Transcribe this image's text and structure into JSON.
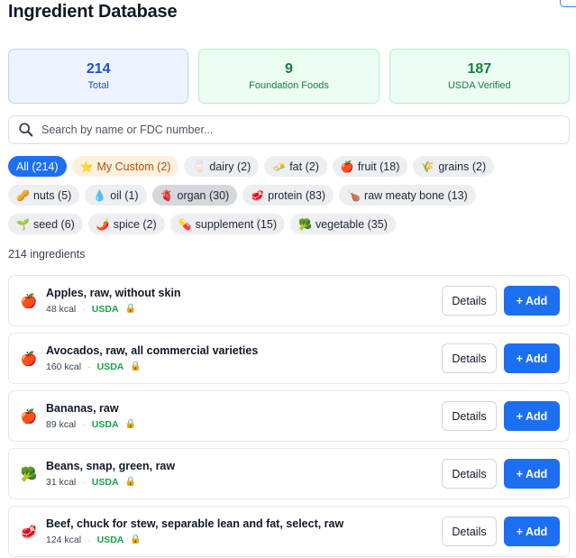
{
  "header": {
    "title": "Ingredient Database",
    "close_label": "✕"
  },
  "stats": [
    {
      "value": "214",
      "label": "Total"
    },
    {
      "value": "9",
      "label": "Foundation Foods"
    },
    {
      "value": "187",
      "label": "USDA Verified"
    }
  ],
  "search": {
    "placeholder": "Search by name or FDC number...",
    "value": ""
  },
  "filters": [
    {
      "label": "All (214)",
      "icon": "",
      "icon_name": ""
    },
    {
      "label": "My Custom (2)",
      "icon": "⭐",
      "icon_name": "star-icon"
    },
    {
      "label": "dairy (2)",
      "icon": "🥛",
      "icon_name": "milk-glass-icon"
    },
    {
      "label": "fat (2)",
      "icon": "🧈",
      "icon_name": "butter-icon"
    },
    {
      "label": "fruit (18)",
      "icon": "🍎",
      "icon_name": "apple-icon"
    },
    {
      "label": "grains (2)",
      "icon": "🌾",
      "icon_name": "wheat-icon"
    },
    {
      "label": "nuts (5)",
      "icon": "🥜",
      "icon_name": "peanut-icon"
    },
    {
      "label": "oil (1)",
      "icon": "💧",
      "icon_name": "droplet-icon"
    },
    {
      "label": "organ (30)",
      "icon": "🫀",
      "icon_name": "heart-organ-icon"
    },
    {
      "label": "protein (83)",
      "icon": "🥩",
      "icon_name": "meat-icon"
    },
    {
      "label": "raw meaty bone (13)",
      "icon": "🍗",
      "icon_name": "drumstick-icon"
    },
    {
      "label": "seed (6)",
      "icon": "🌱",
      "icon_name": "seedling-icon"
    },
    {
      "label": "spice (2)",
      "icon": "🌶️",
      "icon_name": "chili-pepper-icon"
    },
    {
      "label": "supplement (15)",
      "icon": "💊",
      "icon_name": "pill-icon"
    },
    {
      "label": "vegetable (35)",
      "icon": "🥦",
      "icon_name": "broccoli-icon"
    }
  ],
  "results_count": "214 ingredients",
  "ingredients": [
    {
      "icon": "🍎",
      "icon_name": "apple-icon",
      "name": "Apples, raw, without skin",
      "kcal": "48 kcal",
      "source": "USDA"
    },
    {
      "icon": "🍎",
      "icon_name": "apple-icon",
      "name": "Avocados, raw, all commercial varieties",
      "kcal": "160 kcal",
      "source": "USDA"
    },
    {
      "icon": "🍎",
      "icon_name": "apple-icon",
      "name": "Bananas, raw",
      "kcal": "89 kcal",
      "source": "USDA"
    },
    {
      "icon": "🥦",
      "icon_name": "broccoli-icon",
      "name": "Beans, snap, green, raw",
      "kcal": "31 kcal",
      "source": "USDA"
    },
    {
      "icon": "🥩",
      "icon_name": "meat-icon",
      "name": "Beef, chuck for stew, separable lean and fat, select, raw",
      "kcal": "124 kcal",
      "source": "USDA"
    }
  ],
  "row_buttons": {
    "details_label": "Details",
    "add_label": "+ Add"
  },
  "meta_separator": "·",
  "lock_icon": "🔒",
  "colors": {
    "accent": "#1d6ff2",
    "usda_green": "#16a34a",
    "custom_chip": "#fdf0dd"
  }
}
